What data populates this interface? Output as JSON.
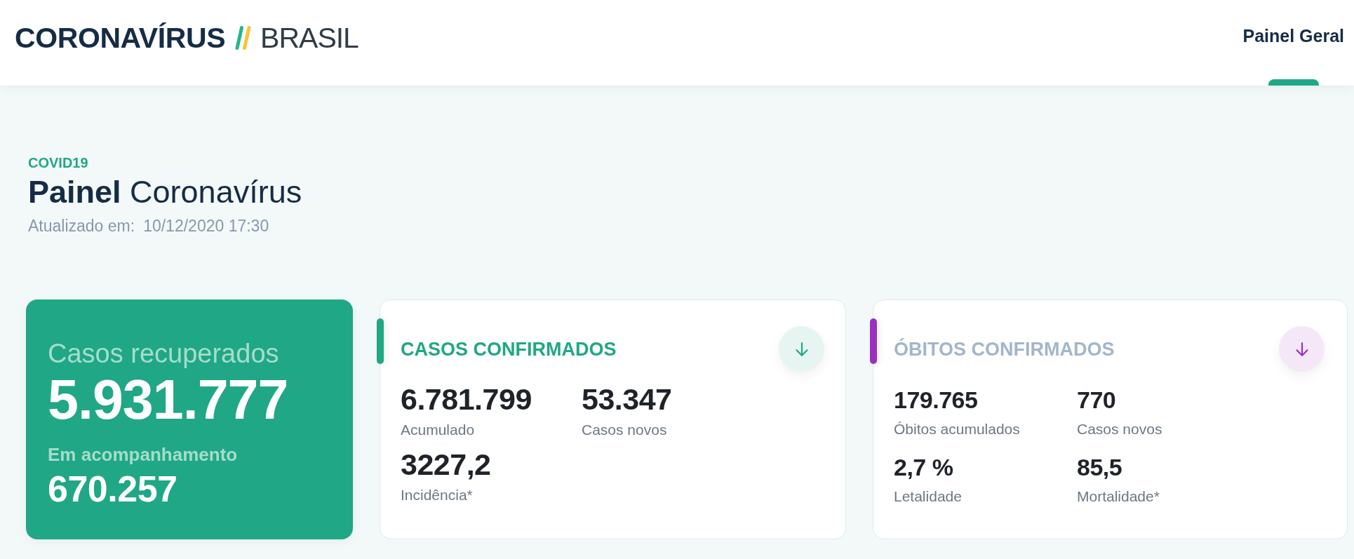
{
  "header": {
    "logo": {
      "title": "CORONAVÍRUS",
      "subtitle": "BRASIL"
    },
    "nav": [
      {
        "label": "Painel Geral",
        "selected": true
      }
    ]
  },
  "intro": {
    "eyebrow": "COVID19",
    "title": "**Painel** Coronavírus",
    "updated_label": "Atualizado em:",
    "updated_value": "10/12/2020 17:30"
  },
  "recovered_card": {
    "title": "Casos recuperados",
    "value": "5.931.777",
    "sub_label": "Em acompanhamento",
    "sub_value": "670.257"
  },
  "stat_cards": [
    {
      "kind": "primary",
      "color": "#1fa883",
      "title": "CASOS CONFIRMADOS",
      "stats": [
        {
          "value": "6.781.799",
          "label": "Acumulado"
        },
        {
          "value": "53.347",
          "label": "Casos novos"
        },
        {
          "value": "3227,2",
          "label": "Incidência*"
        }
      ]
    },
    {
      "kind": "secondary",
      "color": "#9b30c0",
      "title": "ÓBITOS CONFIRMADOS",
      "stats": [
        {
          "value": "179.765",
          "label": "Óbitos acumulados"
        },
        {
          "value": "770",
          "label": "Casos novos"
        },
        {
          "value": "2,7 %",
          "label": "Letalidade"
        },
        {
          "value": "85,5",
          "label": "Mortalidade*"
        }
      ]
    }
  ]
}
